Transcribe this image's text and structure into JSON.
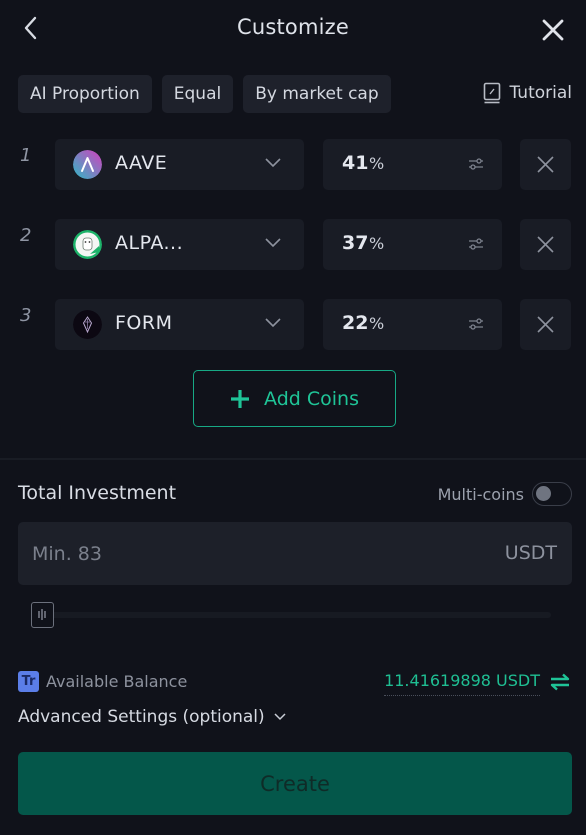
{
  "header": {
    "title": "Customize",
    "back_icon": "chevron-left-icon",
    "close_icon": "close-icon"
  },
  "allocation_modes": [
    {
      "label": "AI Proportion"
    },
    {
      "label": "Equal"
    },
    {
      "label": "By market cap"
    }
  ],
  "tutorial": {
    "label": "Tutorial",
    "icon": "book-icon"
  },
  "coins": [
    {
      "index": "1",
      "symbol": "AAVE",
      "percent": "41",
      "unit": "%",
      "icon": "aave-logo-icon"
    },
    {
      "index": "2",
      "symbol": "ALPA...",
      "percent": "37",
      "unit": "%",
      "icon": "alpaca-logo-icon"
    },
    {
      "index": "3",
      "symbol": "FORM",
      "percent": "22",
      "unit": "%",
      "icon": "form-logo-icon"
    }
  ],
  "add_coins": {
    "label": "Add Coins",
    "icon": "plus-icon"
  },
  "investment": {
    "label": "Total Investment",
    "multi_coins_label": "Multi-coins",
    "multi_coins_enabled": false,
    "amount_value": "",
    "amount_placeholder": "Min. 83",
    "amount_unit": "USDT",
    "slider_percent": 0
  },
  "balance": {
    "badge": "Tr",
    "label": "Available Balance",
    "value": "11.41619898 USDT",
    "transfer_icon": "transfer-arrows-icon"
  },
  "advanced_settings": {
    "label": "Advanced Settings (optional)"
  },
  "create": {
    "label": "Create"
  },
  "colors": {
    "background": "#10121a",
    "surface": "#191c25",
    "accent": "#1fc497",
    "create_button": "#04574a",
    "badge_blue": "#5b7ee8"
  }
}
